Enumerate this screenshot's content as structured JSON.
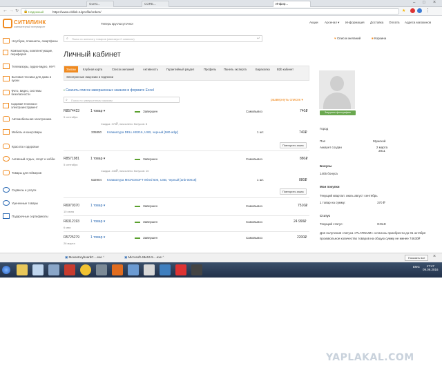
{
  "browser": {
    "tabs": [
      {
        "label": "Инфор..."
      },
      {
        "label": "Guest..."
      },
      {
        "label": "CORE..."
      }
    ],
    "secure_label": "Надежный",
    "url": "https://www.citilink.ru/profile/orders/"
  },
  "header": {
    "logo_text": "СИТИЛИНК",
    "logo_sub": "компьютерный гипермаркет",
    "location_link": "Теперь круглосуточно!",
    "top_links": [
      "Акции",
      "Арсенал ▾",
      "Информация",
      "Доставка",
      "Оплата",
      "Адреса магазинов"
    ],
    "search_placeholder": "Поиск по каталогу товаров (минимум 2 символа)",
    "wishlist": "Список желаний",
    "cart": "Корзина"
  },
  "sidebar": {
    "items": [
      {
        "label": "Ноутбуки, планшеты, смартфоны",
        "icon": "laptop-icon"
      },
      {
        "label": "Компьютеры, комплектующие, периферия",
        "icon": "computer-icon"
      },
      {
        "label": "Телевизоры, аудио-видео, Hi-Fi",
        "icon": "tv-icon"
      },
      {
        "label": "Бытовая техника для дома и кухни",
        "icon": "fridge-icon"
      },
      {
        "label": "Фото, видео, системы безопасности",
        "icon": "camera-icon"
      },
      {
        "label": "Садовая техника и электроинструмент",
        "icon": "drill-icon"
      },
      {
        "label": "Автомобильная электроника",
        "icon": "car-icon"
      },
      {
        "label": "Мебель и канцтовары",
        "icon": "chair-icon"
      },
      {
        "label": "Красота и здоровье",
        "icon": "hairdryer-icon"
      },
      {
        "label": "Активный отдых, спорт и хобби",
        "icon": "bike-icon"
      },
      {
        "label": "Товары для геймеров",
        "icon": "gamepad-icon"
      },
      {
        "label": "Сервисы и услуги",
        "icon": "service-icon"
      },
      {
        "label": "Уцененные товары",
        "icon": "discount-icon"
      },
      {
        "label": "Подарочные сертификаты",
        "icon": "gift-icon"
      }
    ]
  },
  "main": {
    "title": "Личный кабинет",
    "tabs": [
      "Заказы",
      "Клубная карта",
      "Список желаний",
      "Активность",
      "Гарантийный раздел",
      "Профиль",
      "Панель эксперта",
      "Барахолка",
      "B2b кабинет",
      "Электронные лицензии и подписки"
    ],
    "active_tab": 0,
    "excel_link": "Скачать список завершенных заказов в формате Excel",
    "search_placeholder": "Поиск по завершенным заказам",
    "expand_link": "развернуть список ▾",
    "orders": [
      {
        "number": "R8574423",
        "date": "5 сентября",
        "count": "1 товар ▾",
        "status": "Завершен",
        "delivery": "Самовывоз",
        "sum": "740₽",
        "bonus": "Скидка: 370₽, начислено бонусов: 8",
        "item": {
          "code": "335850",
          "name": "Клавиатура DELL KB216, USB, черный [580-adgr]",
          "qty": "1 шт.",
          "price": "740₽"
        },
        "repeat": "Повторить заказ"
      },
      {
        "number": "R8571981",
        "date": "5 сентября",
        "count": "1 товар ▾",
        "status": "Завершен",
        "delivery": "Самовывоз",
        "sum": "880₽",
        "bonus": "Скидка: 440₽, начислено бонусов: 10",
        "item": {
          "code": "632904",
          "name": "Клавиатура MICROSOFT Wired 600, USB, черный [anb-00018]",
          "qty": "1 шт.",
          "price": "880₽"
        },
        "repeat": "Повторить заказ"
      },
      {
        "number": "R6970370",
        "date": "10 июня",
        "count": "1 товар ▾",
        "status": "Завершен",
        "delivery": "Самовывоз",
        "sum": "7510₽"
      },
      {
        "number": "R6312193",
        "date": "6 мая",
        "count": "1 товар ▾",
        "status": "Завершен",
        "delivery": "Самовывоз",
        "sum": "24 990₽"
      },
      {
        "number": "R5725279",
        "date": "26 марта",
        "count": "1 товар ▾",
        "status": "Завершен",
        "delivery": "Самовывоз",
        "sum": "2200₽"
      }
    ]
  },
  "profile": {
    "photo_button": "Загрузить фотографию",
    "city_label": "Город",
    "gender_label": "Пол",
    "gender_value": "Мужской",
    "created_label": "Аккаунт создан",
    "created_value": "2 марта 2011",
    "bonus_title": "Бонусы",
    "bonus_value": "1405 бонуса",
    "purchases_title": "Мои покупки",
    "quarter_label": "Текущий квартал: июль август сентябрь",
    "quarter_sum_label": "1 товар на сумму:",
    "quarter_sum": "370 ₽",
    "status_title": "Статус",
    "status_label": "Текущий статус:",
    "status_value": "GOLD",
    "status_note": "Для получения статуса «PLATINUM» осталось приобрести до 01 октября произвольное количество товаров на общую сумму не менее 74630₽"
  },
  "downloads": {
    "items": [
      "MouseKeyboardC....exe",
      "Microsoft-48e04-5....exe"
    ],
    "show_all": "Показать все"
  },
  "taskbar": {
    "lang": "ENG",
    "time": "17:47",
    "date": "09.09.2016"
  },
  "watermark": "YAPLAKAL.COM",
  "colors": {
    "accent": "#f08a1f",
    "link": "#2a69b3",
    "status": "#5ba02f",
    "photo_button": "#6aa84f"
  }
}
